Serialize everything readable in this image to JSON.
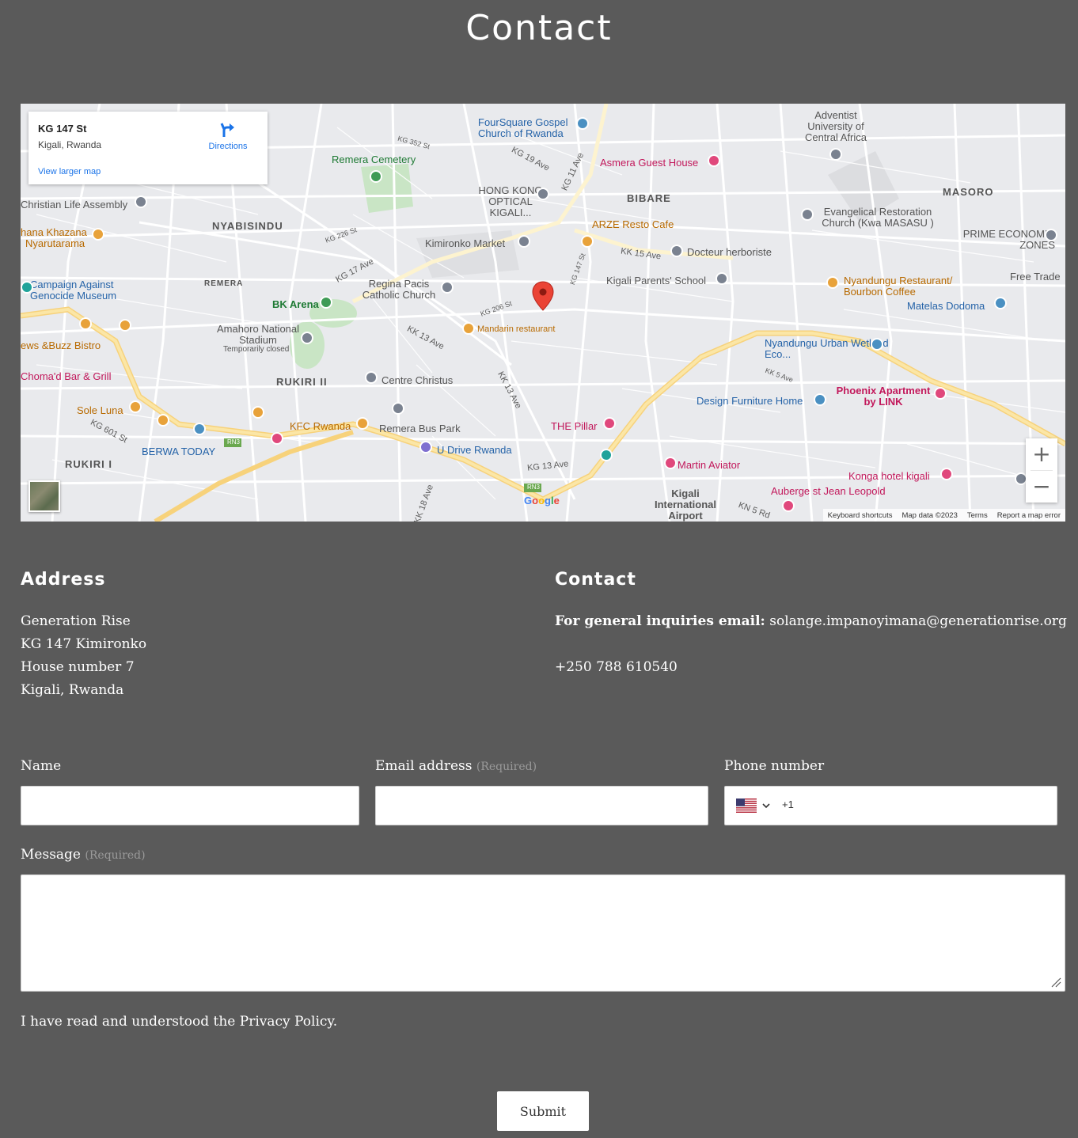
{
  "page": {
    "title": "Contact"
  },
  "map": {
    "place_card": {
      "title": "KG 147 St",
      "subtitle": "Kigali, Rwanda",
      "link": "View larger map",
      "directions": "Directions"
    },
    "labels": {
      "areas": [
        "NYABISINDU",
        "BIBARE",
        "MASORO",
        "REMERA",
        "RUKIRI II",
        "RUKIRI I"
      ],
      "pois": [
        "FourSquare Gospel Church of Rwanda",
        "Asmera Guest House",
        "Adventist University of Central Africa",
        "Remera Cemetery",
        "HONG KONG OPTICAL KIGALI...",
        "Kimironko Market",
        "ARZE Resto Cafe",
        "Docteur herboriste",
        "Evangelical Restoration Church (Kwa MASASU )",
        "PRIME ECONOMIC ZONES",
        "Christian Life Assembly",
        "Nyarutarama",
        "Campaign Against Genocide Museum",
        "BK Arena",
        "Regina Pacis Catholic Church",
        "Kigali Parents' School",
        "Nyandungu Restaurant/ Bourbon Coffee",
        "Matelas Dodoma",
        "Free Trade",
        "Amahoro National Stadium",
        "Temporarily closed",
        "Mandarin restaurant",
        "Nyandungu Urban Wetland Eco...",
        "Centre Christus",
        "Phoenix Apartment by LINK",
        "Design Furniture Home",
        "Sole Luna",
        "KFC Rwanda",
        "Remera Bus Park",
        "THE Pillar",
        "BERWA TODAY",
        "U Drive Rwanda",
        "Martin Aviator",
        "Konga hotel kigali",
        "Auberge st Jean Leopold",
        "Kigali International Airport",
        "ews &Buzz Bistro",
        "Choma'd Bar & Grill",
        "hana Khazana"
      ],
      "streets": [
        "KG 17 Ave",
        "KG 19 Ave",
        "KG 11 Ave",
        "KK 15 Ave",
        "KK 13 Ave",
        "KG 13 Ave",
        "KG 601 St",
        "KK 13 Ave",
        "KN 5 Rd",
        "KK 5 Ave",
        "KK 18 Ave",
        "KG 352 St",
        "KG 147 St",
        "KG 226 St",
        "KG 206 St"
      ]
    },
    "zoom_in": "+",
    "zoom_out": "−",
    "footer": {
      "shortcuts": "Keyboard shortcuts",
      "map_data": "Map data ©2023",
      "terms": "Terms",
      "report": "Report a map error"
    },
    "logo": "Google",
    "road_badge": "RN3"
  },
  "address": {
    "heading": "Address",
    "lines": [
      "Generation Rise",
      "KG 147 Kimironko",
      "House number 7",
      "Kigali, Rwanda"
    ]
  },
  "contact": {
    "heading": "Contact",
    "email_prefix": "For general inquiries email:",
    "email": "solange.impanoyimana@generationrise.org",
    "phone": "+250 788 610540"
  },
  "form": {
    "name_label": "Name",
    "email_label": "Email address",
    "required_tag": "(Required)",
    "phone_label": "Phone number",
    "phone_code": "+1",
    "message_label": "Message",
    "consent_prefix": "I have read and understood the",
    "consent_link": "Privacy Policy",
    "consent_suffix": ".",
    "submit": "Submit"
  }
}
